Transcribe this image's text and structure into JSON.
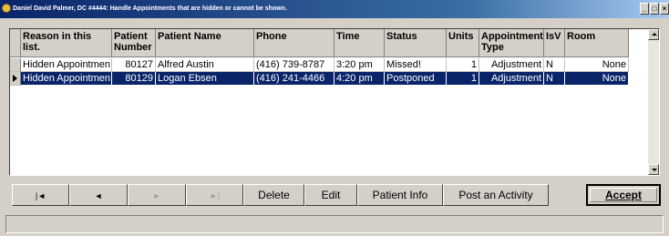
{
  "window": {
    "title": "Daniel David Palmer, DC #4444: Handle Appointments that are hidden or cannot be shown.",
    "controls": [
      "_",
      "□",
      "×"
    ]
  },
  "grid": {
    "columns": [
      {
        "label": "Reason in this list."
      },
      {
        "label": "Patient Number"
      },
      {
        "label": "Patient Name"
      },
      {
        "label": "Phone"
      },
      {
        "label": "Time"
      },
      {
        "label": "Status"
      },
      {
        "label": "Units"
      },
      {
        "label": "Appointment Type"
      },
      {
        "label": "IsV"
      },
      {
        "label": "Room"
      }
    ],
    "rows": [
      {
        "reason": "Hidden Appointmen",
        "number": "80127",
        "name": "Alfred Austin",
        "phone": "(416) 739-8787",
        "time": "3:20 pm",
        "status": "Missed!",
        "units": "1",
        "type": "Adjustment",
        "isv": "N",
        "room": "None",
        "selected": false
      },
      {
        "reason": "Hidden Appointmen",
        "number": "80129",
        "name": "Logan Ebsen",
        "phone": "(416) 241-4466",
        "time": "4:20 pm",
        "status": "Postponed",
        "units": "1",
        "type": "Adjustment",
        "isv": "N",
        "room": "None",
        "selected": true
      }
    ]
  },
  "navigator": {
    "first": "|◄",
    "prior": "◄",
    "next": "►",
    "last": "►|"
  },
  "buttons": {
    "delete": "Delete",
    "edit": "Edit",
    "patient_info": "Patient Info",
    "post_activity": "Post an Activity",
    "accept": "Accept"
  },
  "colors": {
    "selection": "#0a246a",
    "face": "#d4d0c8"
  }
}
